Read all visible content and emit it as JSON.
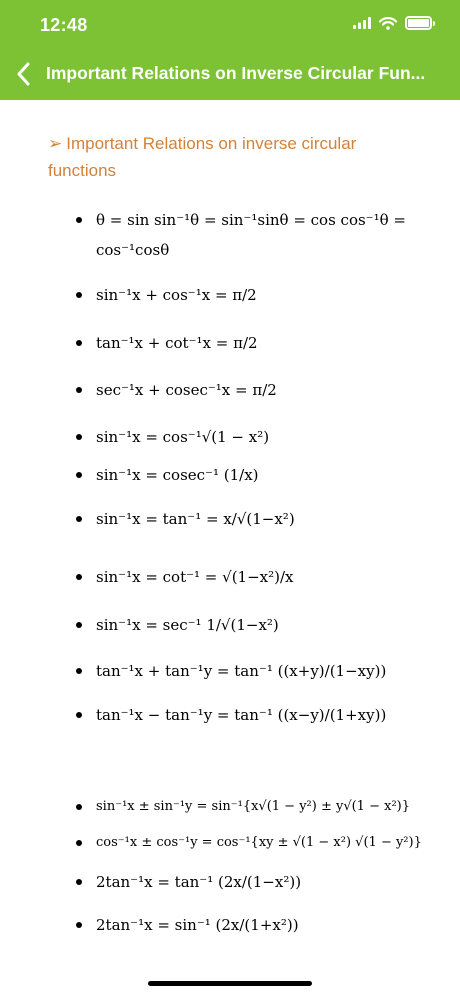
{
  "status_bar": {
    "time": "12:48"
  },
  "nav": {
    "title": "Important Relations on Inverse Circular Fun..."
  },
  "content": {
    "heading_marker": "➢",
    "heading": "Important Relations on inverse circular functions",
    "formulas": [
      "θ = sin sin⁻¹θ = sin⁻¹sinθ = cos cos⁻¹θ = cos⁻¹cosθ",
      "sin⁻¹x + cos⁻¹x = π/2",
      "tan⁻¹x + cot⁻¹x = π/2",
      "sec⁻¹x + cosec⁻¹x = π/2",
      "sin⁻¹x = cos⁻¹√(1 − x²)",
      "sin⁻¹x = cosec⁻¹ (1/x)",
      "sin⁻¹x = tan⁻¹ = x/√(1−x²)",
      "sin⁻¹x = cot⁻¹ = √(1−x²)/x",
      "sin⁻¹x = sec⁻¹ 1/√(1−x²)",
      "tan⁻¹x +  tan⁻¹y = tan⁻¹ ((x+y)/(1−xy))",
      "tan⁻¹x −  tan⁻¹y = tan⁻¹ ((x−y)/(1+xy))",
      "sin⁻¹x ± sin⁻¹y = sin⁻¹{x√(1 − y²) ± y√(1 − x²)}",
      "cos⁻¹x ± cos⁻¹y = cos⁻¹{xy ± √(1 − x²) √(1 − y²)}",
      "2tan⁻¹x = tan⁻¹ (2x/(1−x²))",
      "2tan⁻¹x = sin⁻¹ (2x/(1+x²))"
    ]
  }
}
